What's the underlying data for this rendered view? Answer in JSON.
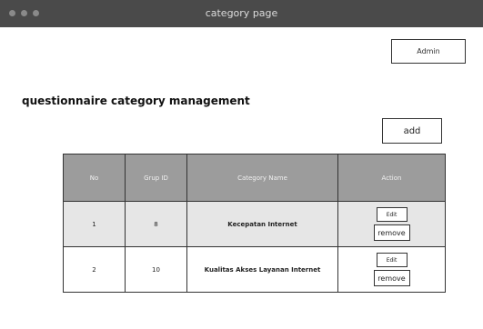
{
  "window": {
    "title": "category page"
  },
  "header": {
    "admin_label": "Admin"
  },
  "page": {
    "heading": "questionnaire category management",
    "add_label": "add"
  },
  "table": {
    "columns": [
      "No",
      "Grup ID",
      "Category Name",
      "Action"
    ],
    "rows": [
      {
        "no": "1",
        "group_id": "8",
        "name": "Kecepatan Internet",
        "edit": "Edit",
        "remove": "remove"
      },
      {
        "no": "2",
        "group_id": "10",
        "name": "Kualitas Akses Layanan Internet",
        "edit": "Edit",
        "remove": "remove"
      }
    ]
  },
  "colors": {
    "titlebar": "#4a4a4a",
    "table_header": "#9c9c9c",
    "row_highlight": "#e6e6e6"
  }
}
